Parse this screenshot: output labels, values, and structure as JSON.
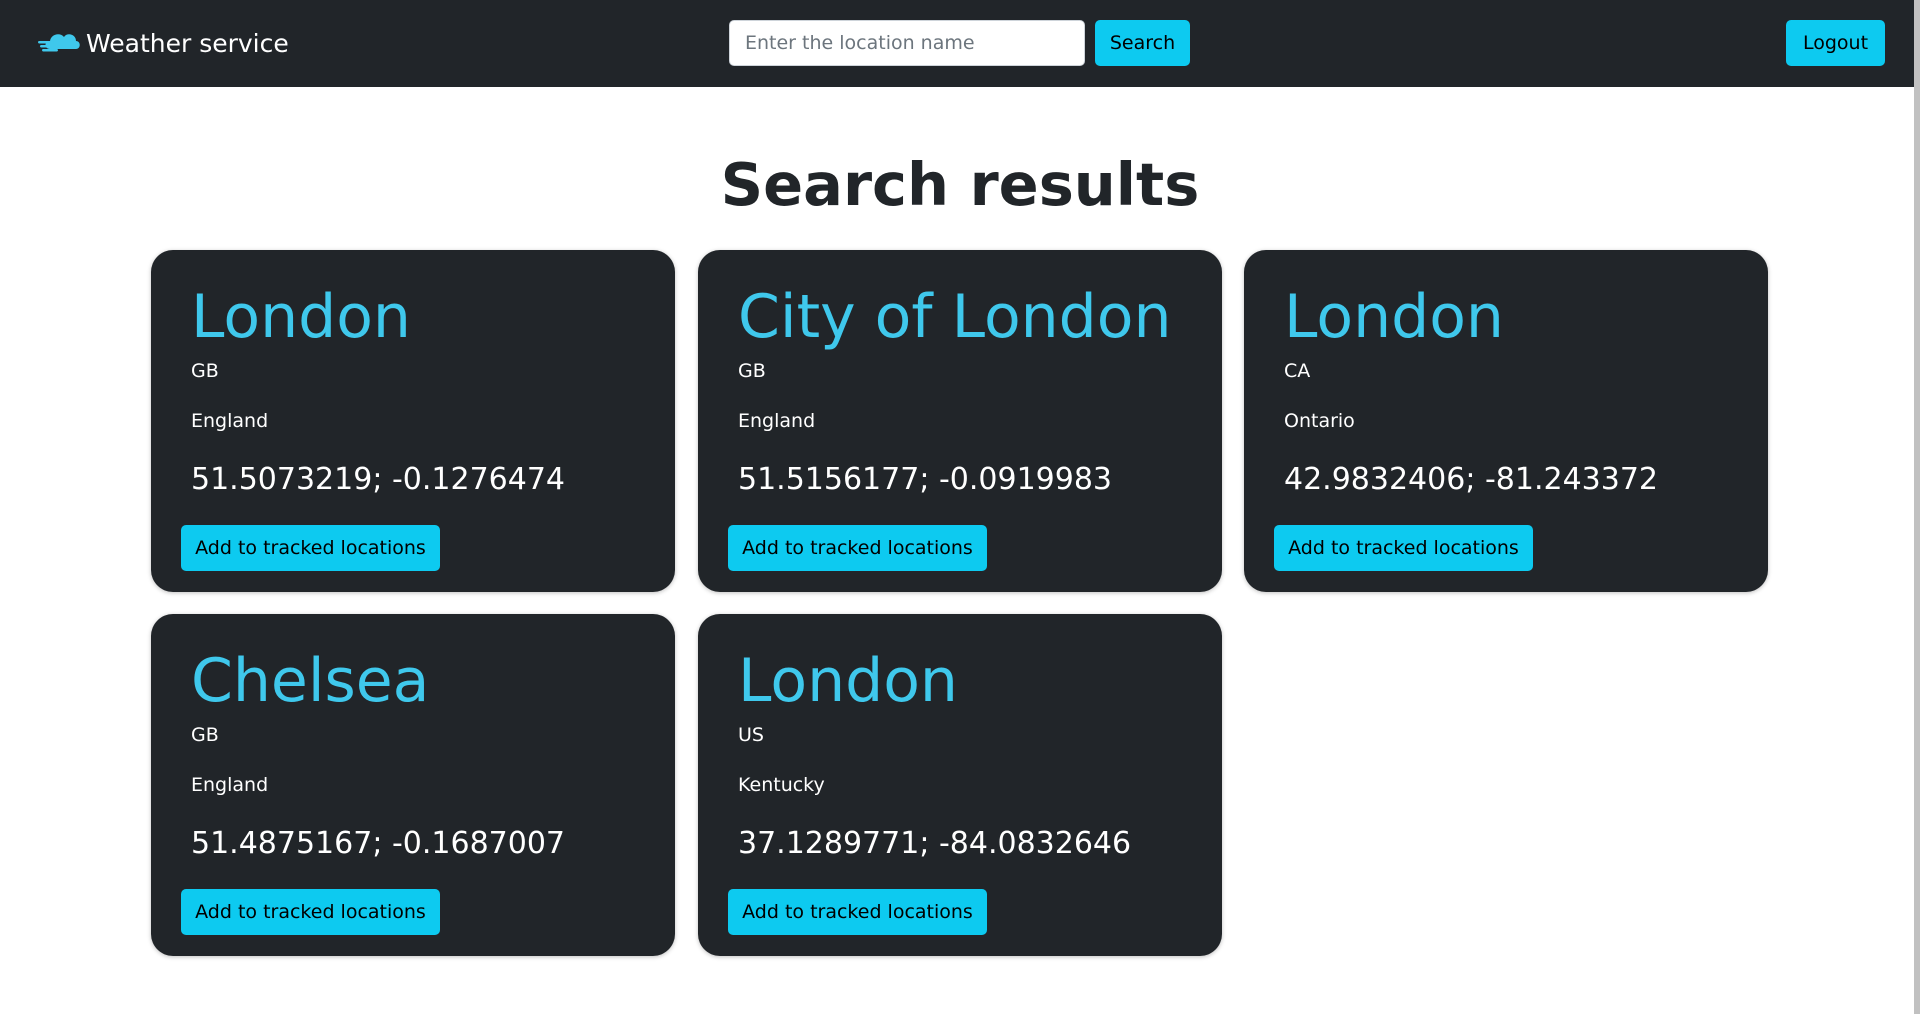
{
  "navbar": {
    "brand": "Weather service",
    "brand_icon": "cloud-icon",
    "search_placeholder": "Enter the location name",
    "search_value": "",
    "search_label": "Search",
    "logout_label": "Logout"
  },
  "page": {
    "title": "Search results"
  },
  "results": [
    {
      "name": "London",
      "country": "GB",
      "region": "England",
      "coords": "51.5073219; -0.1276474",
      "action": "Add to tracked locations"
    },
    {
      "name": "City of London",
      "country": "GB",
      "region": "England",
      "coords": "51.5156177; -0.0919983",
      "action": "Add to tracked locations"
    },
    {
      "name": "London",
      "country": "CA",
      "region": "Ontario",
      "coords": "42.9832406; -81.243372",
      "action": "Add to tracked locations"
    },
    {
      "name": "Chelsea",
      "country": "GB",
      "region": "England",
      "coords": "51.4875167; -0.1687007",
      "action": "Add to tracked locations"
    },
    {
      "name": "London",
      "country": "US",
      "region": "Kentucky",
      "coords": "37.1289771; -84.0832646",
      "action": "Add to tracked locations"
    }
  ],
  "colors": {
    "navbar_bg": "#212529",
    "accent": "#0dcaf0",
    "card_title": "#3fc8ec"
  }
}
